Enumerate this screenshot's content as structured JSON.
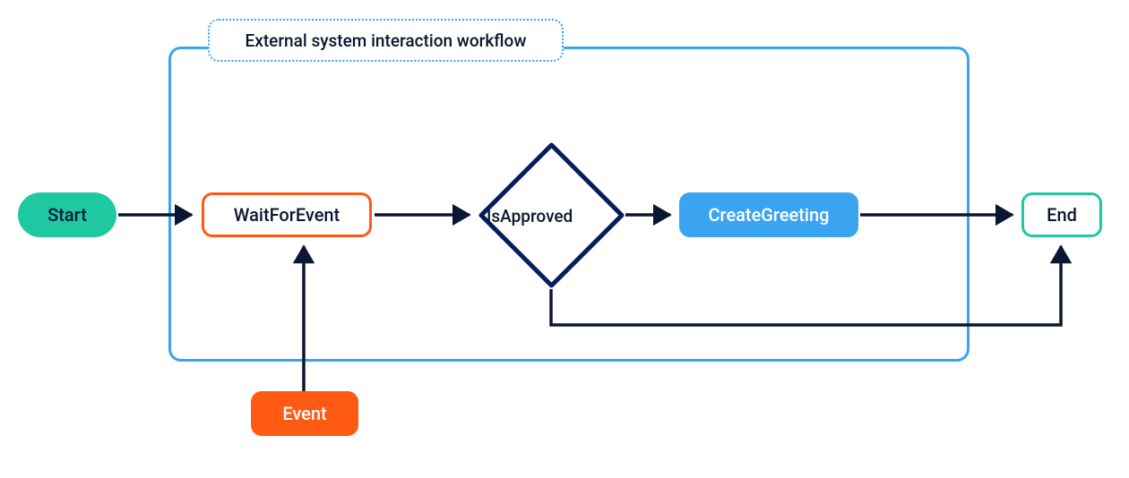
{
  "workflow": {
    "label": "External system interaction workflow"
  },
  "nodes": {
    "start": "Start",
    "wait": "WaitForEvent",
    "isApproved": "IsApproved",
    "createGreeting": "CreateGreeting",
    "end": "End",
    "event": "Event"
  },
  "edges": [
    {
      "from": "start",
      "to": "wait"
    },
    {
      "from": "wait",
      "to": "isApproved"
    },
    {
      "from": "isApproved",
      "to": "createGreeting"
    },
    {
      "from": "createGreeting",
      "to": "end"
    },
    {
      "from": "isApproved",
      "to": "end",
      "note": "bypass"
    },
    {
      "from": "event",
      "to": "wait"
    }
  ],
  "colors": {
    "start_fill": "#1EC8A0",
    "wait_border": "#ff5a13",
    "event_fill": "#ff5a13",
    "create_fill": "#3aa4f0",
    "end_border": "#1EC8A0",
    "flow_border": "#3aa4f0",
    "arrow": "#0b1730",
    "diamond_border": "#071c5a"
  }
}
